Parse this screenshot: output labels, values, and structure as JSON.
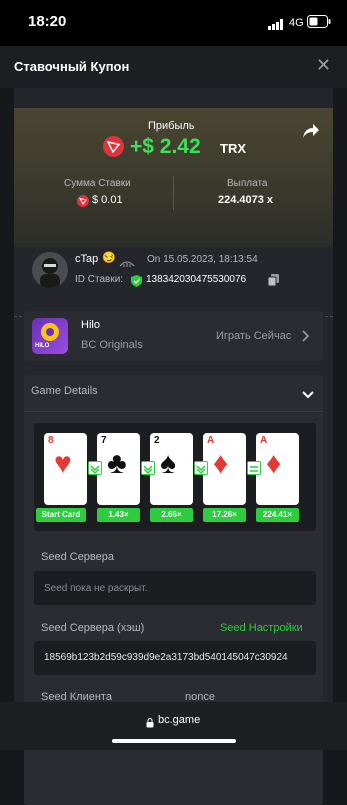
{
  "status_bar": {
    "time": "18:20",
    "network": "4G"
  },
  "header": {
    "title": "Ставочный Купон"
  },
  "profit": {
    "label": "Прибыль",
    "amount": "+$ 2.42",
    "currency": "TRX"
  },
  "stake": {
    "label": "Сумма Ставки",
    "value": "$ 0.01"
  },
  "payout": {
    "label": "Выплата",
    "value": "224.4073 x"
  },
  "user": {
    "name": "cTap",
    "date": "On 15.05.2023, 18:13:54",
    "bet_id_label": "ID Ставки:",
    "bet_id": "1383420304755300​76"
  },
  "game": {
    "name": "Hilo",
    "provider": "BC Originals",
    "play_label": "Играть Сейчас",
    "logo_text": "HILO"
  },
  "details": {
    "label": "Game Details"
  },
  "cards": [
    {
      "rank": "8",
      "suit": "♥"
    },
    {
      "rank": "7",
      "suit": "♣"
    },
    {
      "rank": "2",
      "suit": "♠"
    },
    {
      "rank": "A",
      "suit": "♦"
    },
    {
      "rank": "A",
      "suit": "♦"
    }
  ],
  "multipliers": [
    "Start Card",
    "1.43×",
    "2.66×",
    "17.26×",
    "224.41×"
  ],
  "seeds": {
    "server_label": "Seed Сервера",
    "server_value": "Seed пока не раскрыт.",
    "server_hash_label": "Seed Сервера (хэш)",
    "settings_label": "Seed Настройки",
    "server_hash_value": "18569b123b2d59c939d9e2a3173bd540145047c30924",
    "client_label": "Seed Клиента",
    "nonce_label": "nonce"
  },
  "urlbar": {
    "url": "bc.game"
  },
  "colors": {
    "accent_green": "#2ecc40",
    "profit_green": "#3de05a",
    "tron_red": "#e0323c"
  }
}
